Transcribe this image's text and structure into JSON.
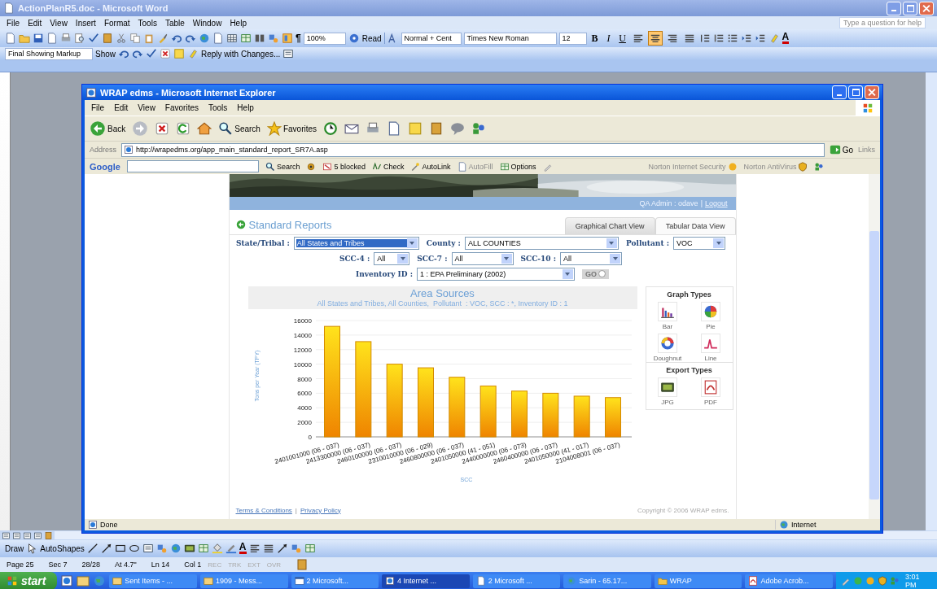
{
  "word": {
    "title": "ActionPlanR5.doc - Microsoft Word",
    "menu": [
      "File",
      "Edit",
      "View",
      "Insert",
      "Format",
      "Tools",
      "Table",
      "Window",
      "Help"
    ],
    "help_placeholder": "Type a question for help",
    "show_marks": "¶",
    "zoom": "100%",
    "read": "Read",
    "style": "Normal + Cent",
    "font": "Times New Roman",
    "size": "12",
    "format_buttons": [
      {
        "label": "B",
        "kind": "bold"
      },
      {
        "label": "I",
        "kind": "italic"
      },
      {
        "label": "U",
        "kind": "underline"
      }
    ],
    "align_buttons": [
      {
        "selected": false
      },
      {
        "selected": true
      },
      {
        "selected": false
      },
      {
        "selected": false
      }
    ],
    "font_color": "A",
    "draw_font_color": "A",
    "markup_view": "Final Showing Markup",
    "show": "Show",
    "reply": "Reply with Changes...",
    "draw": "Draw",
    "autoshapes": "AutoShapes",
    "status": [
      "Page 25",
      "Sec 7",
      "28/28",
      "At 4.7\"",
      "Ln 14",
      "Col 1"
    ],
    "modes": [
      {
        "label": "REC",
        "on": false
      },
      {
        "label": "TRK",
        "on": false
      },
      {
        "label": "EXT",
        "on": false
      },
      {
        "label": "OVR",
        "on": false
      }
    ]
  },
  "ie": {
    "title": "WRAP edms - Microsoft Internet Explorer",
    "menu": [
      "File",
      "Edit",
      "View",
      "Favorites",
      "Tools",
      "Help"
    ],
    "back": "Back",
    "search": "Search",
    "favorites": "Favorites",
    "address_label": "Address",
    "url": "http://wrapedms.org/app_main_standard_report_SR7A.asp",
    "go": "Go",
    "links": "Links",
    "google": {
      "logo": "Google",
      "search": "Search",
      "blocked": "5 blocked",
      "check": "Check",
      "autolink": "AutoLink",
      "autofill": "AutoFill",
      "options": "Options",
      "nis": "Norton Internet Security",
      "nav": "Norton AntiVirus"
    },
    "status": "Done",
    "zone": "Internet"
  },
  "page": {
    "user": "QA Admin : odave",
    "separator": "|",
    "logout": "Logout",
    "heading": "Standard Reports",
    "tabs": [
      {
        "label": "Graphical Chart View",
        "selected": true
      },
      {
        "label": "Tabular Data View",
        "selected": false
      }
    ],
    "filter_rows": [
      [
        {
          "label": "State/Tribal :",
          "value": "All States and Tribes",
          "selected": true
        },
        {
          "label": "County :",
          "value": "ALL COUNTIES",
          "selected": false
        },
        {
          "label": "Pollutant :",
          "value": "VOC",
          "selected": false
        }
      ],
      [
        {
          "label": "SCC-4 :",
          "value": "All",
          "selected": false
        },
        {
          "label": "SCC-7 :",
          "value": "All",
          "selected": false
        },
        {
          "label": "SCC-10 :",
          "value": "All",
          "selected": false
        }
      ],
      [
        {
          "label": "Inventory ID :",
          "value": "1 : EPA Preliminary (2002)",
          "selected": false
        }
      ]
    ],
    "go": "GO",
    "chart_subtitle": "All States and Tribes, All Counties,  Pollutant  : VOC, SCC : *, Inventory ID : 1",
    "chart_data": {
      "type": "bar",
      "title": "Area Sources",
      "xlabel": "SCC",
      "ylabel": "Tons per Year (TPY)",
      "categories": [
        "2401001000 (06 - 037)",
        "2413300000 (06 - 037)",
        "2460100000 (06 - 037)",
        "2310010000 (06 - 029)",
        "2460800000 (06 - 037)",
        "2401050000 (41 - 051)",
        "2440000000 (06 - 073)",
        "2460400000 (06 - 037)",
        "2401050000 (41 - 017)",
        "2104008001 (06 - 037)"
      ],
      "values": [
        15200,
        13100,
        10000,
        9500,
        8200,
        7000,
        6300,
        6000,
        5600,
        5400
      ],
      "grid": true,
      "ylim": [
        0,
        16000
      ],
      "yticks": [
        0,
        2000,
        4000,
        6000,
        8000,
        10000,
        12000,
        14000,
        16000
      ]
    },
    "graph_types": {
      "title": "Graph Types",
      "items": [
        "Bar",
        "Pie",
        "Doughnut",
        "Line"
      ]
    },
    "export_types": {
      "title": "Export Types",
      "items": [
        "JPG",
        "PDF"
      ]
    },
    "footer_links": [
      "Terms & Conditions",
      "Privacy Policy"
    ],
    "copyright": "Copyright © 2006 WRAP edms."
  },
  "taskbar": {
    "start": "start",
    "items": [
      {
        "label": "Sent Items - ...",
        "selected": false
      },
      {
        "label": "1909 - Mess...",
        "selected": false
      },
      {
        "label": "2 Microsoft...",
        "selected": false
      },
      {
        "label": "4 Internet ...",
        "selected": true
      },
      {
        "label": "2 Microsoft ...",
        "selected": false
      },
      {
        "label": "Sarin - 65.17...",
        "selected": false
      },
      {
        "label": "WRAP",
        "selected": false
      },
      {
        "label": "Adobe Acrob...",
        "selected": false
      }
    ],
    "time": "3:01 PM"
  }
}
